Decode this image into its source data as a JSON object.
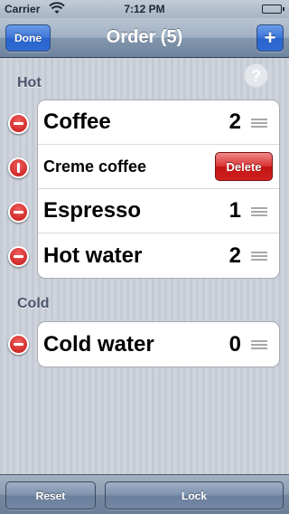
{
  "status_bar": {
    "carrier": "Carrier",
    "time": "7:12 PM",
    "wifi_icon": "wifi-icon",
    "battery_icon": "battery-icon"
  },
  "nav_bar": {
    "title": "Order (5)",
    "done_label": "Done",
    "add_label": "+"
  },
  "help": {
    "label": "?"
  },
  "sections": [
    {
      "title": "Hot",
      "items": [
        {
          "name": "Coffee",
          "quantity": "2"
        },
        {
          "name": "Creme coffee",
          "quantity": "",
          "delete_label": "Delete"
        },
        {
          "name": "Espresso",
          "quantity": "1"
        },
        {
          "name": "Hot water",
          "quantity": "2"
        }
      ]
    },
    {
      "title": "Cold",
      "items": [
        {
          "name": "Cold water",
          "quantity": "0"
        }
      ]
    }
  ],
  "toolbar": {
    "reset_label": "Reset",
    "lock_label": "Lock"
  },
  "colors": {
    "nav_accent": "#3a74d6",
    "delete_red": "#d93030",
    "background": "#c9ced8"
  }
}
